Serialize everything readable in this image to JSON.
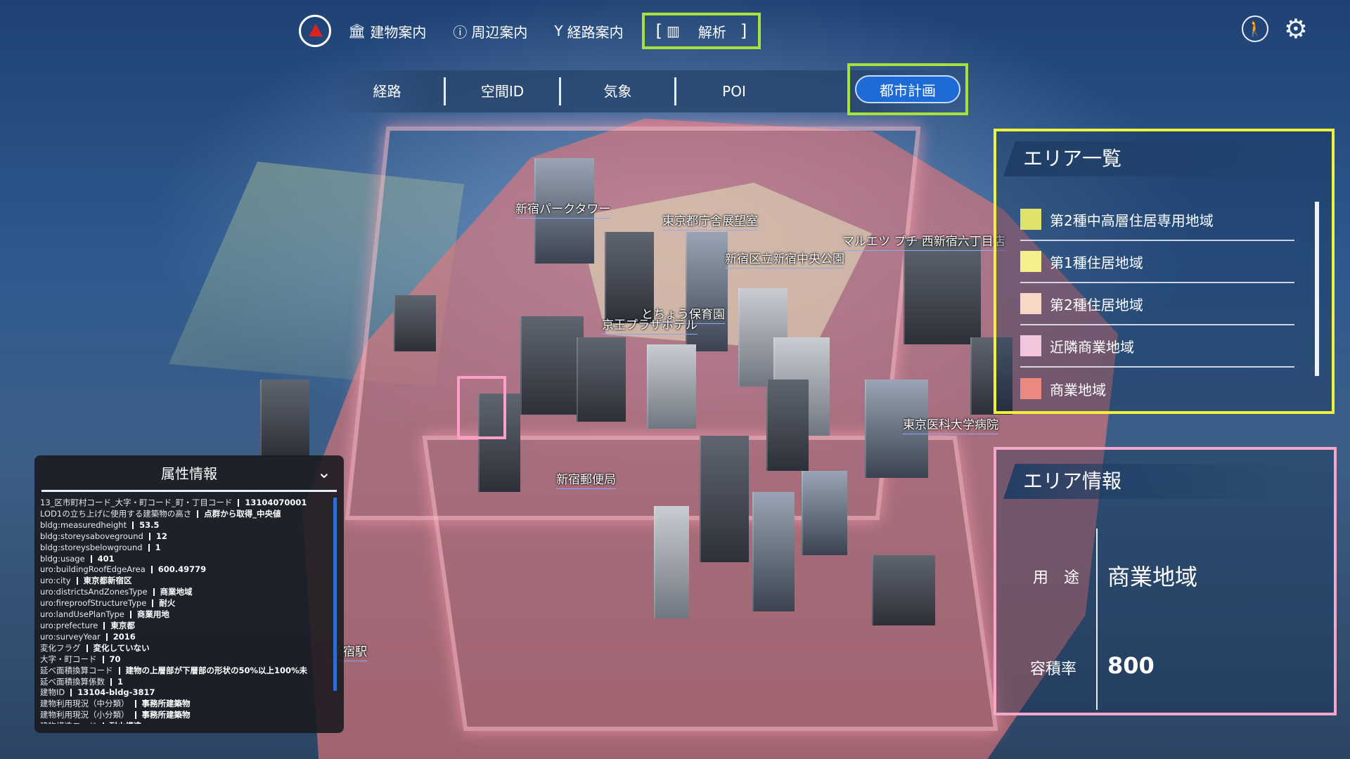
{
  "nav": {
    "items": [
      {
        "label": "建物案内",
        "icon": "building-icon"
      },
      {
        "label": "周辺案内",
        "icon": "info-icon"
      },
      {
        "label": "経路案内",
        "icon": "route-icon"
      }
    ],
    "active": {
      "label": "解析",
      "icon": "chart-icon"
    }
  },
  "subtabs": {
    "items": [
      "経路",
      "空間ID",
      "気象",
      "POI"
    ],
    "active": "都市計画"
  },
  "map_labels": [
    "新宿パークタワー",
    "東京都庁舎展望室",
    "マルエツ プチ 西新宿六丁目店",
    "新宿区立新宿中央公園",
    "とちょう保育園",
    "京王プラザホテル",
    "東京医科大学病院",
    "新宿郵便局",
    "新宿駅"
  ],
  "area_list": {
    "title": "エリア一覧",
    "items": [
      {
        "label": "第2種中高層住居専用地域",
        "color": "#dfe36a"
      },
      {
        "label": "第1種住居地域",
        "color": "#f4ef8c"
      },
      {
        "label": "第2種住居地域",
        "color": "#f7d8c6"
      },
      {
        "label": "近隣商業地域",
        "color": "#f1c6dd"
      },
      {
        "label": "商業地域",
        "color": "#ea8a7e"
      }
    ]
  },
  "area_info": {
    "title": "エリア情報",
    "use_label": "用　途",
    "use_value": "商業地域",
    "far_label": "容積率",
    "far_value": "800"
  },
  "attributes": {
    "title": "属性情報",
    "rows": [
      {
        "k": "13_区市町村コード_大字・町コード_町・丁目コード",
        "v": "13104070001"
      },
      {
        "k": "LOD1の立ち上げに使用する建築物の高さ",
        "v": "点群から取得_中央値"
      },
      {
        "k": "bldg:measuredheight",
        "v": "53.5"
      },
      {
        "k": "bldg:storeysaboveground",
        "v": "12"
      },
      {
        "k": "bldg:storeysbelowground",
        "v": "1"
      },
      {
        "k": "bldg:usage",
        "v": "401"
      },
      {
        "k": "uro:buildingRoofEdgeArea",
        "v": "600.49779"
      },
      {
        "k": "uro:city",
        "v": "東京都新宿区"
      },
      {
        "k": "uro:districtsAndZonesType",
        "v": "商業地域"
      },
      {
        "k": "uro:fireproofStructureType",
        "v": "耐火"
      },
      {
        "k": "uro:landUsePlanType",
        "v": "商業用地"
      },
      {
        "k": "uro:prefecture",
        "v": "東京都"
      },
      {
        "k": "uro:surveyYear",
        "v": "2016"
      },
      {
        "k": "変化フラグ",
        "v": "変化していない"
      },
      {
        "k": "大字・町コード",
        "v": "70"
      },
      {
        "k": "延べ面積換算コード",
        "v": "建物の上層部が下層部の形状の50%以上100%未"
      },
      {
        "k": "延べ面積換算係数",
        "v": "1"
      },
      {
        "k": "建物ID",
        "v": "13104-bldg-3817"
      },
      {
        "k": "建物利用現況（中分類）",
        "v": "事務所建築物"
      },
      {
        "k": "建物利用現況（小分類）",
        "v": "事務所建築物"
      },
      {
        "k": "建物構造コード",
        "v": "耐火構造"
      }
    ]
  }
}
